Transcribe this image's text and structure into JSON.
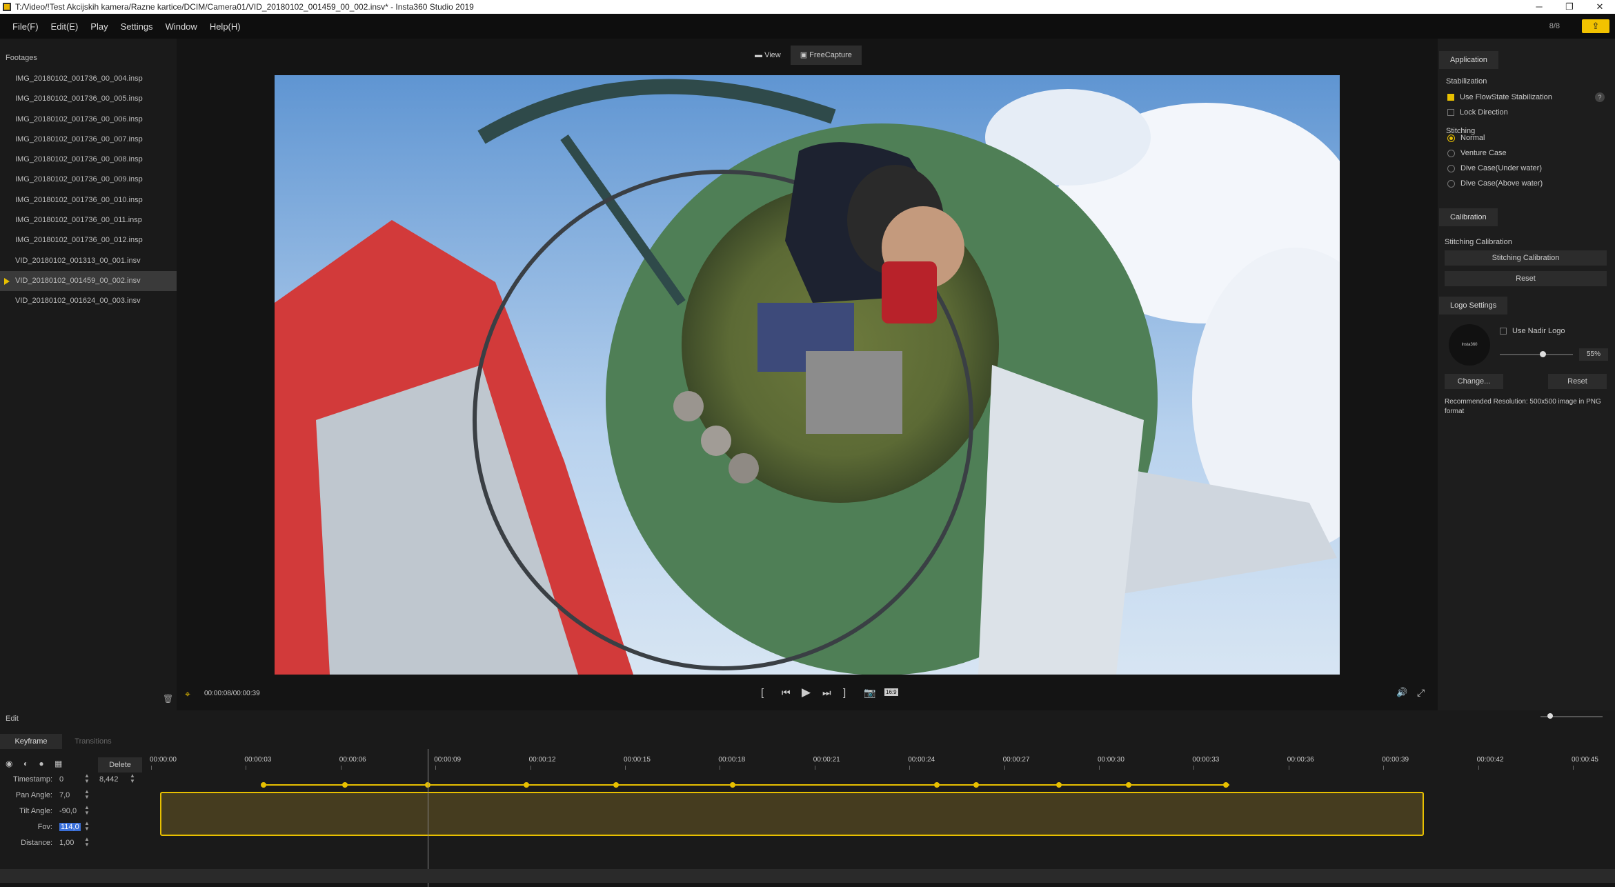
{
  "window": {
    "title": "T:/Video/!Test Akcijskih kamera/Razne kartice/DCIM/Camera01/VID_20180102_001459_00_002.insv* - Insta360 Studio 2019",
    "min_glyph": "─",
    "restore_glyph": "❐",
    "close_glyph": "✕"
  },
  "menu": {
    "items": [
      "File(F)",
      "Edit(E)",
      "Play",
      "Settings",
      "Window",
      "Help(H)"
    ],
    "counter": "8/8",
    "upload_glyph": "⇪"
  },
  "footages": {
    "title": "Footages",
    "items": [
      "IMG_20180102_001736_00_004.insp",
      "IMG_20180102_001736_00_005.insp",
      "IMG_20180102_001736_00_006.insp",
      "IMG_20180102_001736_00_007.insp",
      "IMG_20180102_001736_00_008.insp",
      "IMG_20180102_001736_00_009.insp",
      "IMG_20180102_001736_00_010.insp",
      "IMG_20180102_001736_00_011.insp",
      "IMG_20180102_001736_00_012.insp",
      "VID_20180102_001313_00_001.insv",
      "VID_20180102_001459_00_002.insv",
      "VID_20180102_001624_00_003.insv"
    ],
    "active_index": 10,
    "trash_glyph": "🗑"
  },
  "viewer": {
    "tab_view": "View",
    "tab_freecapture": "FreeCapture",
    "active_tab": "FreeCapture"
  },
  "player": {
    "time": "00:00:08/00:00:39",
    "aspect": "16:9"
  },
  "right_panel": {
    "application_tab": "Application",
    "stabilization_label": "Stabilization",
    "use_flowstate": "Use FlowState Stabilization",
    "use_flowstate_checked": true,
    "help_glyph": "?",
    "lock_direction": "Lock Direction",
    "lock_direction_checked": false,
    "stitching_label": "Stitching",
    "stitching_options": [
      "Normal",
      "Venture Case",
      "Dive Case(Under water)",
      "Dive Case(Above water)"
    ],
    "stitching_selected": "Normal",
    "calibration_tab": "Calibration",
    "stitching_calibration_label": "Stitching Calibration",
    "stitching_calibration_button": "Stitching Calibration",
    "calibration_reset": "Reset",
    "logo_tab": "Logo Settings",
    "use_nadir_logo": "Use Nadir Logo",
    "use_nadir_logo_checked": false,
    "logo_text": "Insta360",
    "logo_opacity": "55%",
    "logo_opacity_value": 0.55,
    "change_button": "Change...",
    "logo_reset": "Reset",
    "recommend_text": "Recommended Resolution: 500x500 image in PNG format"
  },
  "edit": {
    "label": "Edit",
    "tab_keyframe": "Keyframe",
    "tab_transitions": "Transitions",
    "delete_button": "Delete",
    "timestamp_label": "Timestamp:",
    "timestamp_value": "0",
    "timestamp_value2": "8,442",
    "pan_label": "Pan Angle:",
    "pan_value": "7,0",
    "tilt_label": "Tilt Angle:",
    "tilt_value": "-90,0",
    "fov_label": "Fov:",
    "fov_value": "114,0",
    "distance_label": "Distance:",
    "distance_value": "1,00",
    "ticks": [
      "00:00:00",
      "00:00:03",
      "00:00:06",
      "00:00:09",
      "00:00:12",
      "00:00:15",
      "00:00:18",
      "00:00:21",
      "00:00:24",
      "00:00:27",
      "00:00:30",
      "00:00:33",
      "00:00:36",
      "00:00:39",
      "00:00:42",
      "00:00:45"
    ]
  }
}
